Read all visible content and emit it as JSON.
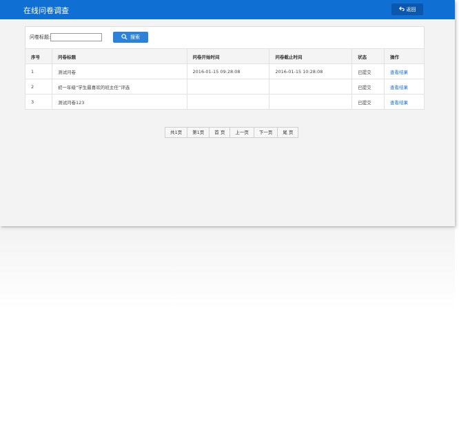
{
  "header": {
    "title": "在线问卷调查",
    "back_label": "返回"
  },
  "search": {
    "label": "问卷标题:",
    "value": "",
    "button_label": "搜索"
  },
  "table": {
    "columns": [
      "序号",
      "问卷标题",
      "问卷开始时间",
      "问卷截止时间",
      "状态",
      "操作"
    ],
    "rows": [
      {
        "no": "1",
        "title": "测试问卷",
        "start": "2016-01-15 09:28:08",
        "end": "2016-01-15 10:28:08",
        "status": "已提交",
        "action": "查看结果"
      },
      {
        "no": "2",
        "title": "初一年级“学生最喜欢的班主任”评选",
        "start": "",
        "end": "",
        "status": "已提交",
        "action": "查看结果"
      },
      {
        "no": "3",
        "title": "测试问卷123",
        "start": "",
        "end": "",
        "status": "已提交",
        "action": "查看结果"
      }
    ]
  },
  "pager": {
    "total": "共1页",
    "current": "第1页",
    "first": "首 页",
    "prev": "上一页",
    "next": "下一页",
    "last": "尾 页"
  },
  "colors": {
    "header_bg": "#0f6fd3",
    "accent": "#2b82d8",
    "link": "#1a6fd0"
  }
}
